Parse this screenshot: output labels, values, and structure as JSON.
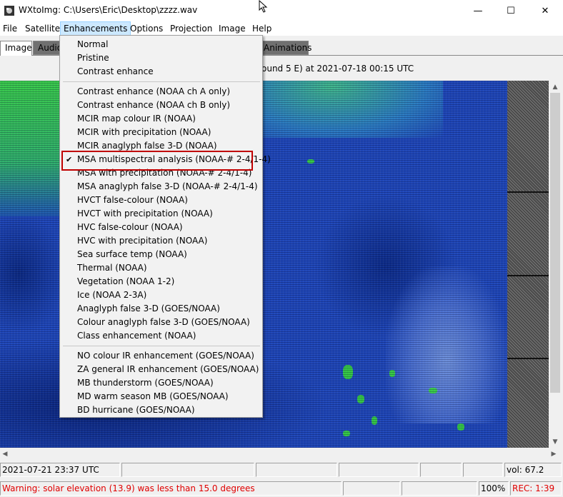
{
  "window": {
    "title": "WXtoImg: C:\\Users\\Eric\\Desktop\\zzzz.wav",
    "minimize": "—",
    "maximize": "☐",
    "close": "✕"
  },
  "menubar": [
    "File",
    "Satellite",
    "Enhancements",
    "Options",
    "Projection",
    "Image",
    "Help"
  ],
  "tabs": {
    "image": "Image",
    "audio": "Audio",
    "animations": "Animations"
  },
  "info_text": "ound  5 E) at 2021-07-18  00:15 UTC",
  "enhancements_menu": {
    "group1": [
      "Normal",
      "Pristine",
      "Contrast enhance"
    ],
    "group2": [
      "Contrast enhance (NOAA ch A only)",
      "Contrast enhance (NOAA ch B only)",
      "MCIR map colour IR (NOAA)",
      "MCIR with precipitation (NOAA)",
      "MCIR anaglyph false 3-D (NOAA)",
      "MSA multispectral analysis (NOAA-# 2-4/1-4)",
      "MSA with precipitation (NOAA-# 2-4/1-4)",
      "MSA anaglyph false 3-D (NOAA-# 2-4/1-4)",
      "HVCT false-colour (NOAA)",
      "HVCT with precipitation (NOAA)",
      "HVC false-colour (NOAA)",
      "HVC with precipitation (NOAA)",
      "Sea surface temp (NOAA)",
      "Thermal (NOAA)",
      "Vegetation (NOAA 1-2)",
      "Ice (NOAA 2-3A)",
      "Anaglyph false 3-D (GOES/NOAA)",
      "Colour anaglyph false 3-D (GOES/NOAA)",
      "Class enhancement (NOAA)"
    ],
    "group3": [
      "NO colour IR enhancement (GOES/NOAA)",
      "ZA general IR enhancement (GOES/NOAA)",
      "MB thunderstorm (GOES/NOAA)",
      "MD warm season MB (GOES/NOAA)",
      "BD hurricane (GOES/NOAA)"
    ],
    "checked_item": "MSA multispectral analysis (NOAA-# 2-4/1-4)",
    "check_mark": "✔"
  },
  "status": {
    "datetime": "2021-07-21  23:37 UTC",
    "vol": "vol: 67.2",
    "warning": "Warning: solar elevation (13.9) was less than 15.0 degrees",
    "zoom": "100%",
    "rec": "REC: 1:39"
  },
  "colors": {
    "highlight_border": "#c00000",
    "menu_active_bg": "#cce8ff",
    "warning_text": "#e00000"
  }
}
